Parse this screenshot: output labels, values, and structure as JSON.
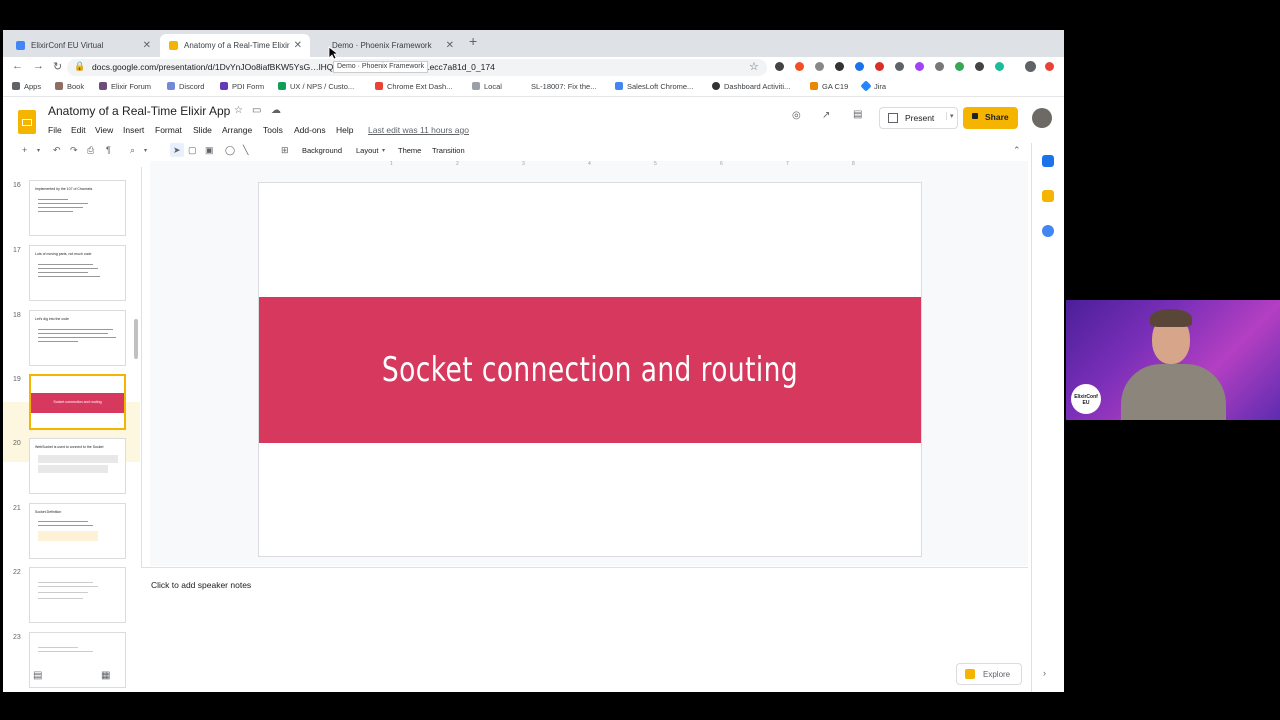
{
  "browser": {
    "tabs": [
      {
        "title": "ElixirConf EU Virtual",
        "color": "#4285f4"
      },
      {
        "title": "Anatomy of a Real-Time Elixir",
        "color": "#f4b400"
      },
      {
        "title": "Demo · Phoenix Framework",
        "color": ""
      }
    ],
    "url": "docs.google.com/presentation/d/1DvYnJOo8iafBKW5YsG…lHQULBNM/edit#slide=id.g81ecc7a81d_0_174",
    "tooltip": "Demo · Phoenix Framework",
    "bookmarks": [
      "Apps",
      "Book",
      "Elixir Forum",
      "Discord",
      "PDI Form",
      "UX / NPS / Custo...",
      "Chrome Ext Dash...",
      "Local",
      "SL-18007: Fix the...",
      "SalesLoft Chrome...",
      "Dashboard Activiti...",
      "GA C19",
      "Jira"
    ]
  },
  "slides": {
    "doc_title": "Anatomy of a Real-Time Elixir App",
    "menu": [
      "File",
      "Edit",
      "View",
      "Insert",
      "Format",
      "Slide",
      "Arrange",
      "Tools",
      "Add-ons",
      "Help"
    ],
    "last_edit": "Last edit was 11 hours ago",
    "present_label": "Present",
    "share_label": "Share",
    "toolbar": {
      "background": "Background",
      "layout": "Layout",
      "theme": "Theme",
      "transition": "Transition"
    },
    "ruler": [
      "1",
      "2",
      "3",
      "4",
      "5",
      "6",
      "7",
      "8",
      "9"
    ],
    "thumbnails": [
      {
        "num": "16",
        "title": "Implemented by the 107 of Channels"
      },
      {
        "num": "17",
        "title": "Lots of moving parts, not much code"
      },
      {
        "num": "18",
        "title": "Let's dig into the code"
      },
      {
        "num": "19",
        "title": "Socket connection and routing"
      },
      {
        "num": "20",
        "title": "WebSocket is used to connect to the Socket"
      },
      {
        "num": "21",
        "title": "Socket Definition"
      },
      {
        "num": "22",
        "title": ""
      },
      {
        "num": "23",
        "title": ""
      }
    ],
    "current_slide": {
      "title": "Socket connection and routing",
      "band_color": "#d7385e"
    },
    "speaker_notes": "Click to add speaker notes",
    "explore_label": "Explore"
  },
  "webcam": {
    "logo_text": "ElixirConf EU"
  }
}
